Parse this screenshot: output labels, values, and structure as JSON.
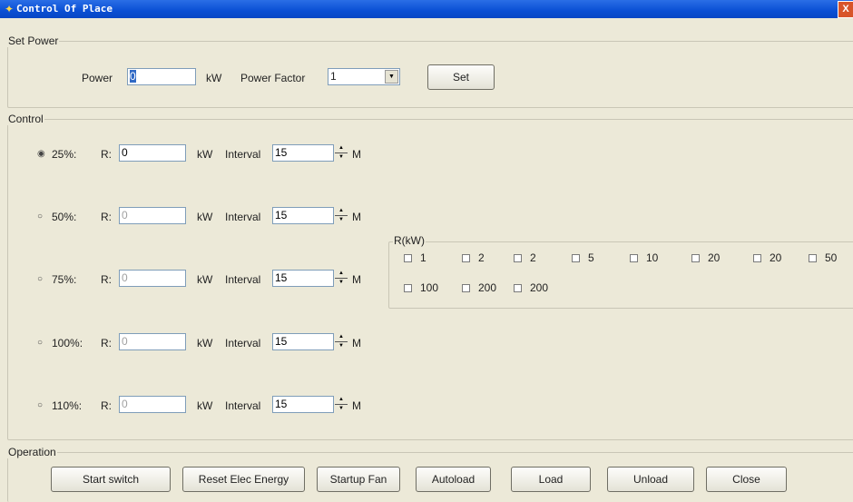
{
  "window": {
    "title": "Control Of Place",
    "close_glyph": "X"
  },
  "set_power": {
    "legend": "Set Power",
    "power_label": "Power",
    "power_value": "0",
    "power_unit": "kW",
    "pf_label": "Power Factor",
    "pf_value": "1",
    "set_label": "Set"
  },
  "control": {
    "legend": "Control",
    "r_label": "R:",
    "unit": "kW",
    "interval_label": "Interval",
    "minute_label": "M",
    "rows": [
      {
        "pct": "25%:",
        "r": "0",
        "interval": "15",
        "selected": true
      },
      {
        "pct": "50%:",
        "r": "0",
        "interval": "15",
        "selected": false
      },
      {
        "pct": "75%:",
        "r": "0",
        "interval": "15",
        "selected": false
      },
      {
        "pct": "100%:",
        "r": "0",
        "interval": "15",
        "selected": false
      },
      {
        "pct": "110%:",
        "r": "0",
        "interval": "15",
        "selected": false
      }
    ]
  },
  "rkw": {
    "legend": "R(kW)",
    "items": [
      "1",
      "2",
      "2",
      "5",
      "10",
      "20",
      "20",
      "50",
      "100",
      "200",
      "200"
    ]
  },
  "operation": {
    "legend": "Operation",
    "buttons": [
      "Start switch",
      "Reset Elec Energy",
      "Startup Fan",
      "Autoload",
      "Load",
      "Unload",
      "Close"
    ]
  }
}
